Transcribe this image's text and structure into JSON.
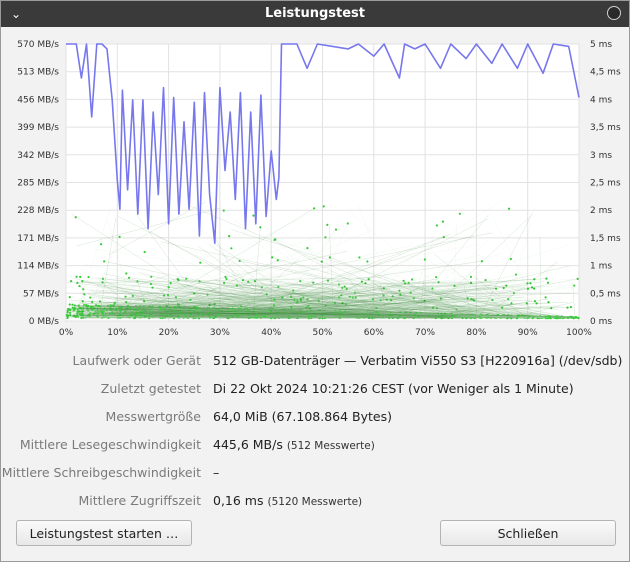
{
  "window": {
    "title": "Leistungstest"
  },
  "chart_data": {
    "type": "line",
    "x_ticks": [
      "0%",
      "10%",
      "20%",
      "30%",
      "40%",
      "50%",
      "60%",
      "70%",
      "80%",
      "90%",
      "100%"
    ],
    "y_left_ticks": [
      "0 MB/s",
      "57 MB/s",
      "114 MB/s",
      "171 MB/s",
      "228 MB/s",
      "285 MB/s",
      "342 MB/s",
      "399 MB/s",
      "456 MB/s",
      "513 MB/s",
      "570 MB/s"
    ],
    "y_right_ticks": [
      "0 ms",
      "0,5 ms",
      "1 ms",
      "1,5 ms",
      "2 ms",
      "2,5 ms",
      "3 ms",
      "3,5 ms",
      "4 ms",
      "4,5 ms",
      "5 ms"
    ],
    "y_left_range": [
      0,
      570
    ],
    "y_right_range": [
      0,
      5
    ],
    "x_range": [
      0,
      100
    ],
    "grid": true,
    "series": [
      {
        "kind": "read_rate",
        "color": "#7777ee",
        "axis": "left",
        "points": [
          [
            0,
            570
          ],
          [
            2,
            570
          ],
          [
            3,
            500
          ],
          [
            4,
            570
          ],
          [
            5,
            420
          ],
          [
            6,
            570
          ],
          [
            7,
            570
          ],
          [
            8,
            560
          ],
          [
            9,
            455
          ],
          [
            10,
            290
          ],
          [
            10.5,
            230
          ],
          [
            11,
            475
          ],
          [
            12,
            270
          ],
          [
            13,
            455
          ],
          [
            14,
            220
          ],
          [
            15,
            455
          ],
          [
            16,
            190
          ],
          [
            17,
            430
          ],
          [
            18,
            260
          ],
          [
            19,
            480
          ],
          [
            20,
            200
          ],
          [
            21,
            460
          ],
          [
            22,
            220
          ],
          [
            23,
            410
          ],
          [
            24,
            230
          ],
          [
            25,
            450
          ],
          [
            26,
            175
          ],
          [
            27,
            470
          ],
          [
            28,
            260
          ],
          [
            29,
            160
          ],
          [
            30,
            480
          ],
          [
            31,
            310
          ],
          [
            32,
            430
          ],
          [
            33,
            250
          ],
          [
            34,
            470
          ],
          [
            35,
            190
          ],
          [
            36,
            430
          ],
          [
            37,
            200
          ],
          [
            38,
            465
          ],
          [
            39,
            215
          ],
          [
            40,
            350
          ],
          [
            41,
            250
          ],
          [
            41.5,
            295
          ],
          [
            42,
            570
          ],
          [
            45,
            570
          ],
          [
            47,
            520
          ],
          [
            49,
            570
          ],
          [
            55,
            560
          ],
          [
            57,
            570
          ],
          [
            60,
            545
          ],
          [
            62,
            570
          ],
          [
            65,
            500
          ],
          [
            66,
            570
          ],
          [
            68,
            560
          ],
          [
            70,
            570
          ],
          [
            73,
            520
          ],
          [
            75,
            570
          ],
          [
            78,
            540
          ],
          [
            80,
            570
          ],
          [
            83,
            530
          ],
          [
            85,
            570
          ],
          [
            88,
            520
          ],
          [
            90,
            570
          ],
          [
            93,
            510
          ],
          [
            95,
            570
          ],
          [
            98,
            565
          ],
          [
            100,
            460
          ]
        ]
      },
      {
        "kind": "access_time",
        "color": "#33cc33",
        "axis": "right",
        "count": 5120,
        "range_ms": [
          0,
          2.2
        ]
      }
    ]
  },
  "fields": [
    {
      "label": "Laufwerk oder Gerät",
      "value": "512 GB-Datenträger — Verbatim Vi550 S3 [H220916a] (/dev/sdb)",
      "sub": ""
    },
    {
      "label": "Zuletzt getestet",
      "value": "Di 22 Okt 2024 10:21:26 CEST (vor Weniger als 1 Minute)",
      "sub": ""
    },
    {
      "label": "Messwertgröße",
      "value": "64,0 MiB (67.108.864 Bytes)",
      "sub": ""
    },
    {
      "label": "Mittlere Lesegeschwindigkeit",
      "value": "445,6 MB/s",
      "sub": "(512 Messwerte)"
    },
    {
      "label": "Mittlere Schreibgeschwindigkeit",
      "value": "–",
      "sub": ""
    },
    {
      "label": "Mittlere Zugriffszeit",
      "value": "0,16 ms",
      "sub": "(5120 Messwerte)"
    }
  ],
  "buttons": {
    "start": "Leistungstest starten …",
    "close": "Schließen"
  }
}
